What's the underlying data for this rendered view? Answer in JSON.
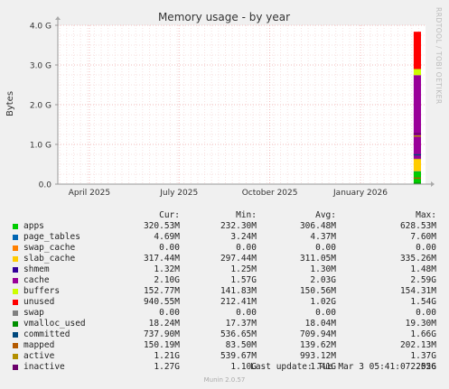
{
  "chart_data": {
    "type": "area",
    "title": "Memory usage - by year",
    "ylabel": "Bytes",
    "ylim": [
      0,
      4000000000
    ],
    "y_ticks": [
      0,
      1000000000,
      2000000000,
      3000000000,
      4000000000
    ],
    "y_tick_labels": [
      "0.0",
      "1.0 G",
      "2.0 G",
      "3.0 G",
      "4.0 G"
    ],
    "x_tick_labels": [
      "April 2025",
      "July 2025",
      "October 2025",
      "January 2026"
    ],
    "x_range": [
      "2025-02-28",
      "2026-03-08"
    ],
    "x_ticks": [
      "2025-04-01",
      "2025-07-01",
      "2025-10-01",
      "2026-01-01"
    ],
    "data_start": "2026-02-24",
    "grid": true,
    "series": [
      {
        "name": "apps",
        "color": "#00cc00",
        "value": 320530000
      },
      {
        "name": "page_tables",
        "color": "#0066b3",
        "value": 4690000
      },
      {
        "name": "swap_cache",
        "color": "#ff8000",
        "value": 0
      },
      {
        "name": "slab_cache",
        "color": "#ffcc00",
        "value": 317440000
      },
      {
        "name": "shmem",
        "color": "#330099",
        "value": 1320000
      },
      {
        "name": "cache",
        "color": "#990099",
        "value": 2100000000
      },
      {
        "name": "buffers",
        "color": "#ccff00",
        "value": 152770000
      },
      {
        "name": "unused",
        "color": "#ff0000",
        "value": 940550000
      },
      {
        "name": "swap",
        "color": "#808080",
        "value": 0
      },
      {
        "name": "vmalloc_used",
        "color": "#008f00",
        "value": 18240000
      },
      {
        "name": "committed",
        "color": "#00487d",
        "value": 737900000
      },
      {
        "name": "mapped",
        "color": "#b35a00",
        "value": 150190000
      },
      {
        "name": "active",
        "color": "#b38f00",
        "value": 1210000000
      },
      {
        "name": "inactive",
        "color": "#6b006b",
        "value": 1270000000
      }
    ]
  },
  "legend": {
    "headers": {
      "cur": "Cur:",
      "min": "Min:",
      "avg": "Avg:",
      "max": "Max:"
    },
    "rows": [
      {
        "name": "apps",
        "color": "#00cc00",
        "cur": "320.53M",
        "min": "232.30M",
        "avg": "306.48M",
        "max": "628.53M"
      },
      {
        "name": "page_tables",
        "color": "#0066b3",
        "cur": "4.69M",
        "min": "3.24M",
        "avg": "4.37M",
        "max": "7.60M"
      },
      {
        "name": "swap_cache",
        "color": "#ff8000",
        "cur": "0.00",
        "min": "0.00",
        "avg": "0.00",
        "max": "0.00"
      },
      {
        "name": "slab_cache",
        "color": "#ffcc00",
        "cur": "317.44M",
        "min": "297.44M",
        "avg": "311.05M",
        "max": "335.26M"
      },
      {
        "name": "shmem",
        "color": "#330099",
        "cur": "1.32M",
        "min": "1.25M",
        "avg": "1.30M",
        "max": "1.48M"
      },
      {
        "name": "cache",
        "color": "#990099",
        "cur": "2.10G",
        "min": "1.57G",
        "avg": "2.03G",
        "max": "2.59G"
      },
      {
        "name": "buffers",
        "color": "#ccff00",
        "cur": "152.77M",
        "min": "141.83M",
        "avg": "150.56M",
        "max": "154.31M"
      },
      {
        "name": "unused",
        "color": "#ff0000",
        "cur": "940.55M",
        "min": "212.41M",
        "avg": "1.02G",
        "max": "1.54G"
      },
      {
        "name": "swap",
        "color": "#808080",
        "cur": "0.00",
        "min": "0.00",
        "avg": "0.00",
        "max": "0.00"
      },
      {
        "name": "vmalloc_used",
        "color": "#008f00",
        "cur": "18.24M",
        "min": "17.37M",
        "avg": "18.04M",
        "max": "19.30M"
      },
      {
        "name": "committed",
        "color": "#00487d",
        "cur": "737.90M",
        "min": "536.65M",
        "avg": "709.94M",
        "max": "1.66G"
      },
      {
        "name": "mapped",
        "color": "#b35a00",
        "cur": "150.19M",
        "min": "83.50M",
        "avg": "139.62M",
        "max": "202.13M"
      },
      {
        "name": "active",
        "color": "#b38f00",
        "cur": "1.21G",
        "min": "539.67M",
        "avg": "993.12M",
        "max": "1.37G"
      },
      {
        "name": "inactive",
        "color": "#6b006b",
        "cur": "1.27G",
        "min": "1.10G",
        "avg": "1.41G",
        "max": "2.55G"
      }
    ]
  },
  "footer": {
    "last_update": "Last update: Tue Mar  3 05:41:07 2026",
    "munin_version": "Munin 2.0.57",
    "rrdtool": "RRDTOOL / TOBI OETIKER"
  }
}
